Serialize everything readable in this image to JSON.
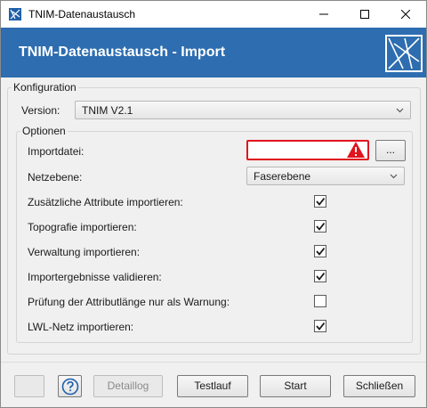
{
  "window": {
    "title": "TNIM-Datenaustausch",
    "app_icon": "tnim-app-icon"
  },
  "banner": {
    "title": "TNIM-Datenaustausch - Import",
    "logo": "tnim-logo"
  },
  "konfiguration": {
    "legend": "Konfiguration",
    "version_label": "Version:",
    "version_value": "TNIM V2.1"
  },
  "optionen": {
    "legend": "Optionen",
    "importdatei_label": "Importdatei:",
    "importdatei_value": "",
    "browse_label": "...",
    "netzebene_label": "Netzebene:",
    "netzebene_value": "Faserebene",
    "checkboxes": [
      {
        "label": "Zusätzliche Attribute importieren:",
        "checked": true
      },
      {
        "label": "Topografie importieren:",
        "checked": true
      },
      {
        "label": "Verwaltung importieren:",
        "checked": true
      },
      {
        "label": "Importergebnisse validieren:",
        "checked": true
      },
      {
        "label": "Prüfung der Attributlänge nur als Warnung:",
        "checked": false
      },
      {
        "label": "LWL-Netz importieren:",
        "checked": true
      }
    ]
  },
  "footer": {
    "detaillog_label": "Detaillog",
    "testlauf_label": "Testlauf",
    "start_label": "Start",
    "schliessen_label": "Schließen"
  },
  "colors": {
    "banner": "#2d6db0",
    "error_border": "#e0141e",
    "help_icon": "#1f5fa8"
  }
}
